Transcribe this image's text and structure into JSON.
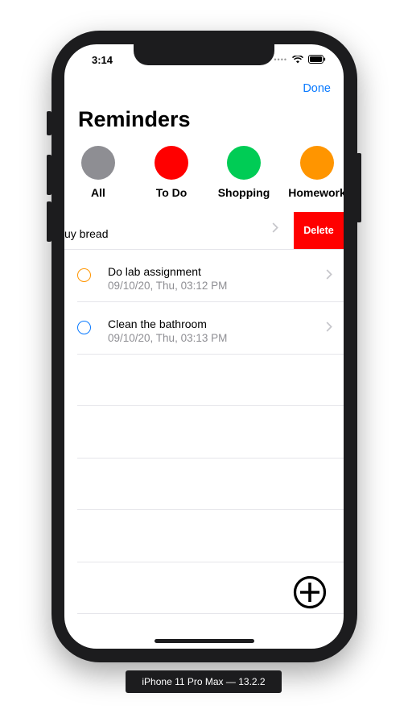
{
  "status_bar": {
    "time": "3:14",
    "signal": "••••"
  },
  "nav": {
    "done_label": "Done"
  },
  "header": {
    "title": "Reminders"
  },
  "categories": [
    {
      "label": "All",
      "color": "#8e8e93"
    },
    {
      "label": "To Do",
      "color": "#ff0000"
    },
    {
      "label": "Shopping",
      "color": "#00cc55"
    },
    {
      "label": "Homework",
      "color": "#ff9500"
    }
  ],
  "swiped_row": {
    "text": "uy bread",
    "delete_label": "Delete"
  },
  "reminders": [
    {
      "title": "Do lab assignment",
      "date": "09/10/20, Thu, 03:12 PM",
      "color": "#ff9500"
    },
    {
      "title": "Clean the bathroom",
      "date": "09/10/20, Thu, 03:13 PM",
      "color": "#0a7aff"
    }
  ],
  "device_label": "iPhone 11 Pro Max — 13.2.2"
}
